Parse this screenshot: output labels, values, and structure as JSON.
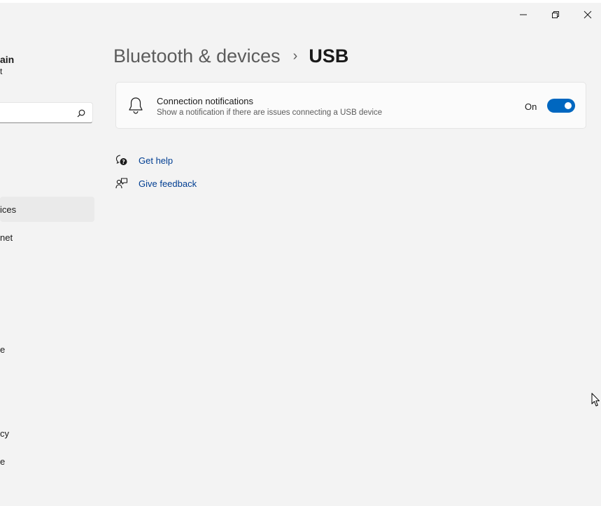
{
  "window": {
    "minimize_icon": "minimize-icon",
    "restore_icon": "restore-icon",
    "close_icon": "close-icon"
  },
  "sidebar": {
    "user_name": "ain",
    "user_sub": "t",
    "search_icon": "search-icon",
    "items": [
      {
        "label": "ices",
        "selected": true
      },
      {
        "label": "net",
        "selected": false
      },
      {
        "label": "e",
        "selected": false
      },
      {
        "label": "cy",
        "selected": false
      },
      {
        "label": "e",
        "selected": false
      }
    ]
  },
  "breadcrumb": {
    "parent": "Bluetooth & devices",
    "separator": "›",
    "current": "USB"
  },
  "setting": {
    "icon": "bell-icon",
    "title": "Connection notifications",
    "description": "Show a notification if there are issues connecting a USB device",
    "state_label": "On",
    "toggle_on": true,
    "accent_color": "#0067c0"
  },
  "links": {
    "help": {
      "label": "Get help",
      "icon": "help-chat-icon"
    },
    "feedback": {
      "label": "Give feedback",
      "icon": "feedback-icon"
    }
  }
}
